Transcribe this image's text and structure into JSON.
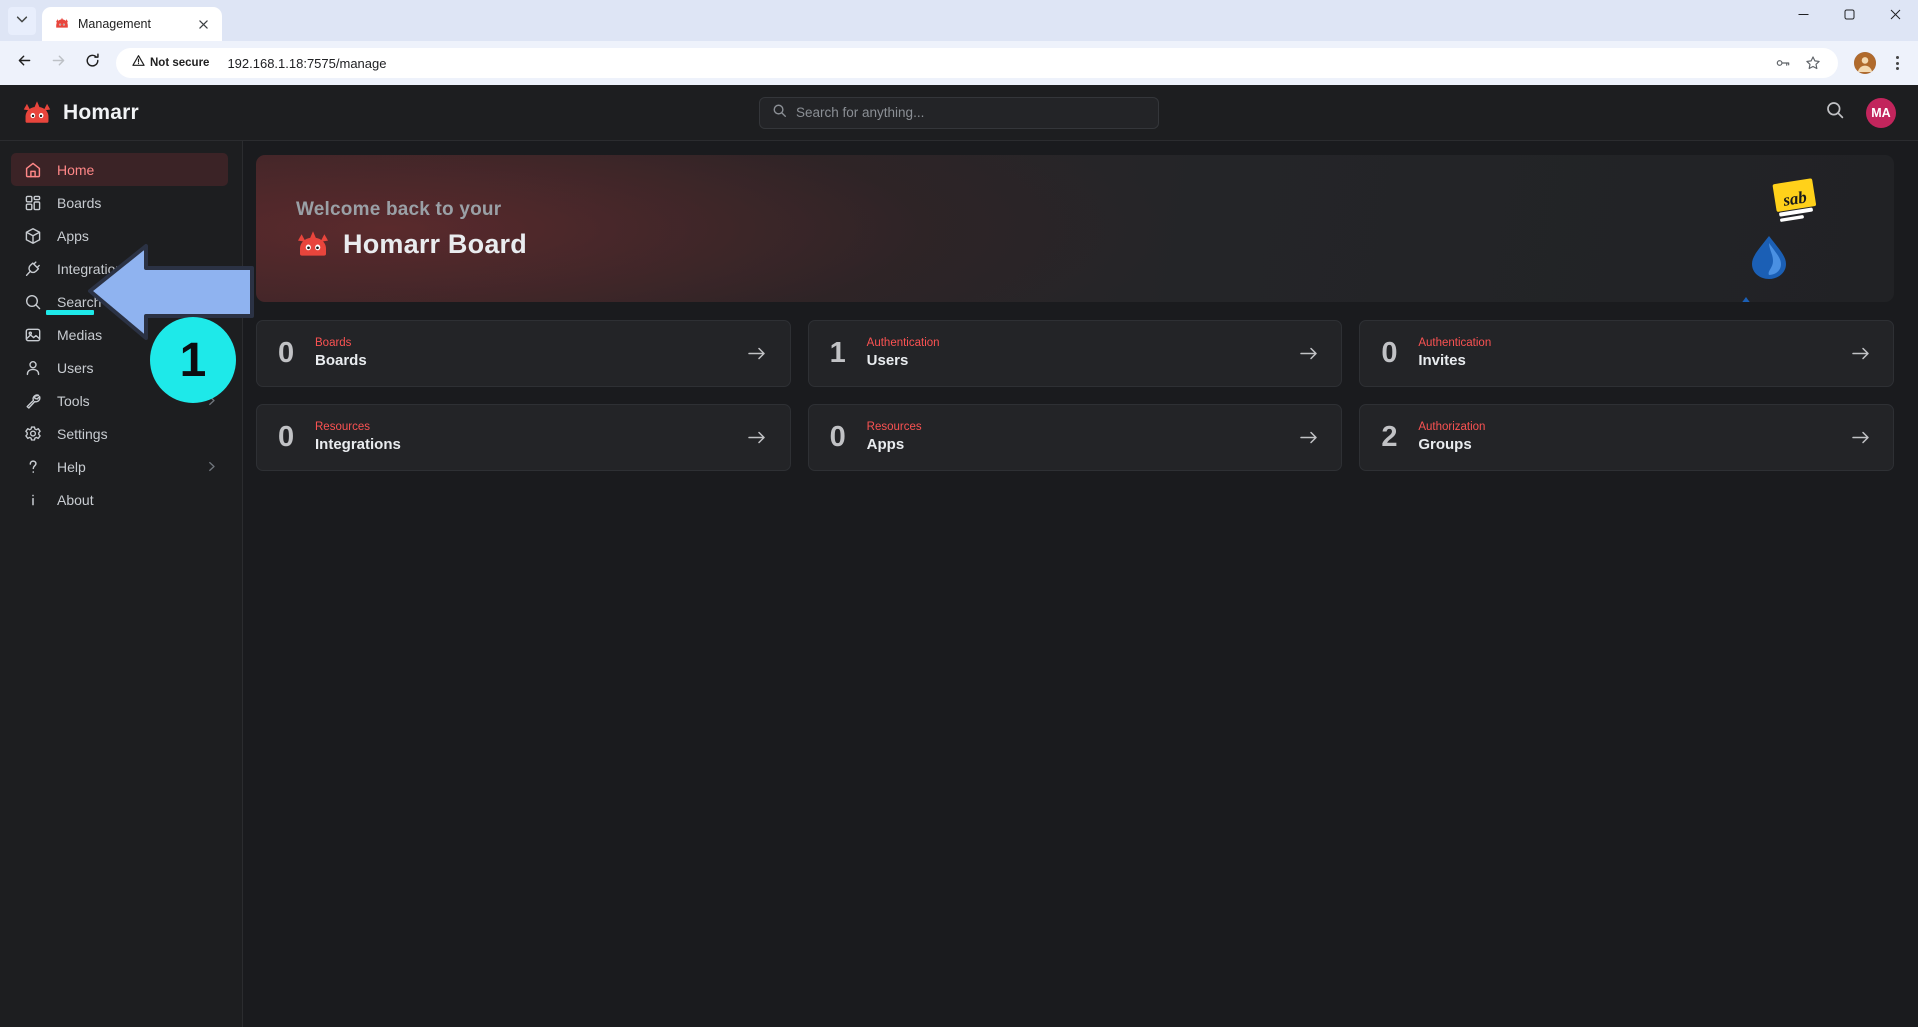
{
  "browser": {
    "tab": {
      "title": "Management",
      "favicon": "homarr-icon"
    },
    "tab_list_icon": "chevron-down-icon",
    "close_tab_icon": "close-icon",
    "nav": {
      "back_icon": "arrow-left-icon",
      "forward_icon": "arrow-right-icon",
      "reload_icon": "reload-icon"
    },
    "omnibox": {
      "security_label": "Not secure",
      "security_icon": "warning-triangle-icon",
      "url": "192.168.1.18:7575/manage",
      "password_icon": "password-key-icon",
      "bookmark_icon": "star-icon"
    },
    "profile_icon": "profile-avatar",
    "menu_icon": "kebab-menu-icon",
    "window": {
      "minimize_icon": "minimize-icon",
      "maximize_icon": "maximize-icon",
      "close_icon": "window-close-icon"
    }
  },
  "app": {
    "brand": {
      "name": "Homarr",
      "logo": "homarr-logo-icon"
    },
    "search": {
      "placeholder": "Search for anything...",
      "icon": "search-icon"
    },
    "header_actions": {
      "search_icon": "search-icon",
      "avatar_initials": "MA"
    },
    "sidebar": {
      "items": [
        {
          "label": "Home",
          "icon": "home-icon",
          "active": true,
          "chevron": false
        },
        {
          "label": "Boards",
          "icon": "boards-grid-icon",
          "active": false,
          "chevron": false
        },
        {
          "label": "Apps",
          "icon": "cube-icon",
          "active": false,
          "chevron": false
        },
        {
          "label": "Integrations",
          "icon": "plug-icon",
          "active": false,
          "chevron": false
        },
        {
          "label": "Search engines",
          "icon": "search-icon",
          "active": false,
          "chevron": false
        },
        {
          "label": "Medias",
          "icon": "photo-icon",
          "active": false,
          "chevron": false
        },
        {
          "label": "Users",
          "icon": "user-icon",
          "active": false,
          "chevron": true
        },
        {
          "label": "Tools",
          "icon": "wrench-icon",
          "active": false,
          "chevron": true
        },
        {
          "label": "Settings",
          "icon": "gear-icon",
          "active": false,
          "chevron": false
        },
        {
          "label": "Help",
          "icon": "question-mark-icon",
          "active": false,
          "chevron": true
        },
        {
          "label": "About",
          "icon": "info-icon",
          "active": false,
          "chevron": false
        }
      ]
    },
    "banner": {
      "subtitle": "Welcome back to your",
      "title": "Homarr Board",
      "logo": "homarr-logo-icon"
    },
    "cards": [
      {
        "count": "0",
        "category": "Boards",
        "label": "Boards",
        "arrow": "arrow-right-icon"
      },
      {
        "count": "1",
        "category": "Authentication",
        "label": "Users",
        "arrow": "arrow-right-icon"
      },
      {
        "count": "0",
        "category": "Authentication",
        "label": "Invites",
        "arrow": "arrow-right-icon"
      },
      {
        "count": "0",
        "category": "Resources",
        "label": "Integrations",
        "arrow": "arrow-right-icon"
      },
      {
        "count": "0",
        "category": "Resources",
        "label": "Apps",
        "arrow": "arrow-right-icon"
      },
      {
        "count": "2",
        "category": "Authorization",
        "label": "Groups",
        "arrow": "arrow-right-icon"
      }
    ]
  },
  "annotation": {
    "step_number": "1",
    "badge_color": "#1ee9e9",
    "arrow_color": "#8fb3f0",
    "points_at": "Boards"
  }
}
